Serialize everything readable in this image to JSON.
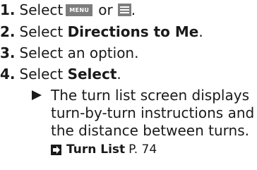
{
  "steps": [
    {
      "number": "1.",
      "prefix": "Select",
      "menu_icon_text": "MENU",
      "connector": "or",
      "suffix": "."
    },
    {
      "number": "2.",
      "prefix": "Select",
      "bold": "Directions to Me",
      "suffix": "."
    },
    {
      "number": "3.",
      "text": "Select an option."
    },
    {
      "number": "4.",
      "prefix": "Select",
      "bold": "Select",
      "suffix": "."
    }
  ],
  "result": {
    "lines": [
      "The turn list screen displays",
      "turn-by-turn instructions and",
      "the distance between turns."
    ]
  },
  "xref": {
    "label": "Turn List",
    "page": "P. 74"
  },
  "colors": {
    "text": "#1a1a1a",
    "icon_gray": "#7d7d7d"
  },
  "icons": [
    "menu-button-icon",
    "list-menu-icon",
    "result-triangle-icon",
    "cross-reference-arrow-icon"
  ]
}
